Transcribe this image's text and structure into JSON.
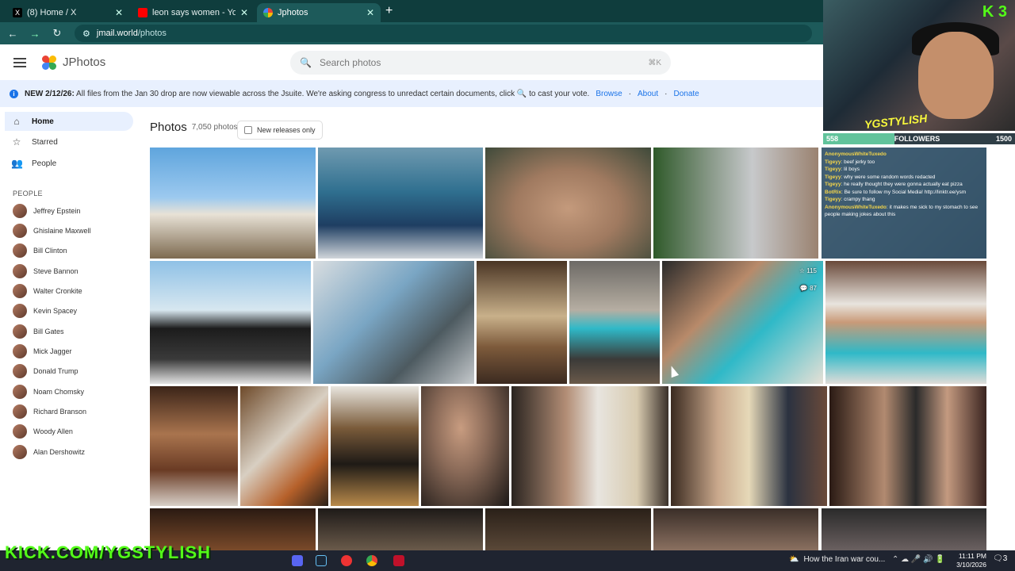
{
  "browser": {
    "tabs": [
      {
        "title": "(8) Home / X",
        "color": "#000000"
      },
      {
        "title": "leon says women - YouTube",
        "color": "#ff0000"
      },
      {
        "title": "Jphotos",
        "color": "#4caf50"
      }
    ],
    "url_host": "jmail.world",
    "url_path": "/photos"
  },
  "app": {
    "brand": "JPhotos",
    "search_placeholder": "Search photos",
    "search_shortcut": "⌘K"
  },
  "banner": {
    "date": "NEW 2/12/26:",
    "text": "All files from the Jan 30 drop are now viewable across the Jsuite. We're asking congress to unredact certain documents, click 🔍 to cast your vote.",
    "links": [
      "Browse",
      "About",
      "Donate"
    ]
  },
  "sidebar": {
    "nav": [
      {
        "label": "Home",
        "icon": "home-icon"
      },
      {
        "label": "Starred",
        "icon": "star-icon"
      },
      {
        "label": "People",
        "icon": "people-icon"
      }
    ],
    "people_title": "PEOPLE",
    "people": [
      "Jeffrey Epstein",
      "Ghislaine Maxwell",
      "Bill Clinton",
      "Steve Bannon",
      "Walter Cronkite",
      "Kevin Spacey",
      "Bill Gates",
      "Mick Jagger",
      "Donald Trump",
      "Noam Chomsky",
      "Richard Branson",
      "Woody Allen",
      "Alan Dershowitz"
    ]
  },
  "main": {
    "title": "Photos",
    "count": "7,050 photos",
    "filter_label": "New releases only",
    "badge_stars": "☆ 115",
    "badge_comments": "💬 87"
  },
  "overlay": {
    "kick_badge": "3",
    "tag": "YGSTYLISH",
    "followers_label": "FOLLOWERS",
    "followers_current": "558",
    "followers_goal": "1500",
    "followers_progress": 0.372,
    "chat": [
      {
        "user": "AnonymousWhiteTuxedo",
        "msg": ""
      },
      {
        "user": "Tigeyy",
        "msg": "beef jerky too"
      },
      {
        "user": "Tigeyy",
        "msg": "lil boys"
      },
      {
        "user": "Tigeyy",
        "msg": "why were some random words redacted"
      },
      {
        "user": "Tigeyy",
        "msg": "he really thought they were gonna actually eat pizza"
      },
      {
        "user": "BotRix",
        "msg": "Be sure to follow my Social Media! http://linktr.ee/ysm"
      },
      {
        "user": "Tigeyy",
        "msg": "crampy thang"
      },
      {
        "user": "AnonymousWhiteTuxedo",
        "msg": "it makes me sick to my stomach to see people making jokes about this"
      }
    ],
    "kick_url": "KICK.COM/YGSTYLISH"
  },
  "taskbar": {
    "news": "How the Iran war cou...",
    "time": "11:11 PM",
    "date": "3/10/2026",
    "notif": "3"
  }
}
